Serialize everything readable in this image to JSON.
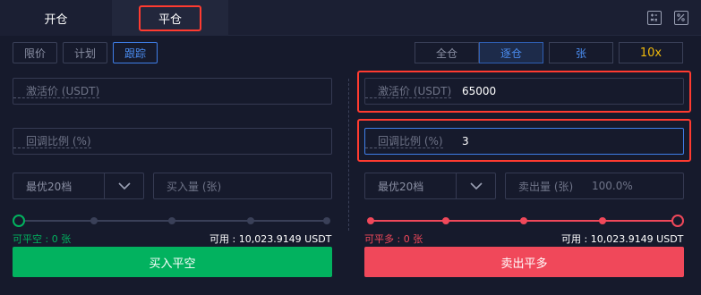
{
  "tabs": {
    "open": "开仓",
    "close": "平仓"
  },
  "order_modes": [
    "限价",
    "计划",
    "跟踪"
  ],
  "margin": {
    "cross": "全仓",
    "isolated": "逐仓",
    "unit": "张",
    "leverage": "10x"
  },
  "left": {
    "activation_label": "激活价 (USDT)",
    "callback_label": "回调比例 (%)",
    "price_select": "最优20档",
    "amount_label": "买入量 (张)",
    "closable_label": "可平空 :",
    "closable_value": "0 张",
    "available_label": "可用 :",
    "available_value": "10,023.9149 USDT",
    "action": "买入平空",
    "slider_percent": 0
  },
  "right": {
    "activation_label": "激活价 (USDT)",
    "activation_value": "65000",
    "callback_label": "回调比例 (%)",
    "callback_value": "3",
    "price_select": "最优20档",
    "amount_label": "卖出量 (张)",
    "amount_pct": "100.0%",
    "closable_label": "可平多 :",
    "closable_value": "0 张",
    "available_label": "可用 :",
    "available_value": "10,023.9149 USDT",
    "action": "卖出平多",
    "slider_percent": 100
  },
  "colors": {
    "buy": "#02b25f",
    "sell": "#f0485a",
    "accent": "#3f7ee8",
    "leverage": "#f0b90b",
    "highlight": "#ff3b30"
  },
  "icons": [
    "calculator-icon",
    "percent-icon",
    "chevron-down-icon"
  ]
}
